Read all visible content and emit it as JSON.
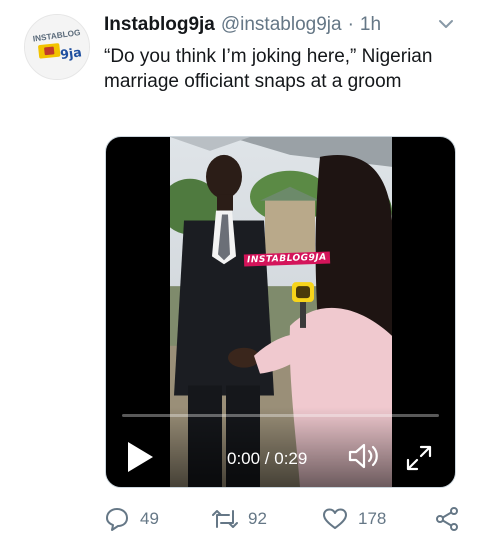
{
  "tweet": {
    "avatar_alt": "Instablog9ja logo",
    "avatar_text": "INSTABLOG",
    "avatar_mark": "9ja",
    "name": "Instablog9ja",
    "handle": "@instablog9ja",
    "separator": "·",
    "time": "1h",
    "text": "“Do you think I’m joking here,” Nigerian marriage officiant snaps at a groom",
    "caret_icon": "chevron-down-icon"
  },
  "media": {
    "type": "video",
    "watermark": "INSTABLOG9JA",
    "progress": 0.0,
    "timecode": "0:00 / 0:29",
    "play_icon": "play-icon",
    "volume_icon": "volume-icon",
    "expand_icon": "expand-icon"
  },
  "actions": {
    "reply": {
      "icon": "reply-icon",
      "count": "49"
    },
    "retweet": {
      "icon": "retweet-icon",
      "count": "92"
    },
    "like": {
      "icon": "heart-icon",
      "count": "178"
    },
    "share": {
      "icon": "share-icon"
    }
  },
  "colors": {
    "text": "#14171a",
    "secondary": "#657786",
    "border": "#ccd6dd",
    "watermark_bg": "#d4145a"
  }
}
